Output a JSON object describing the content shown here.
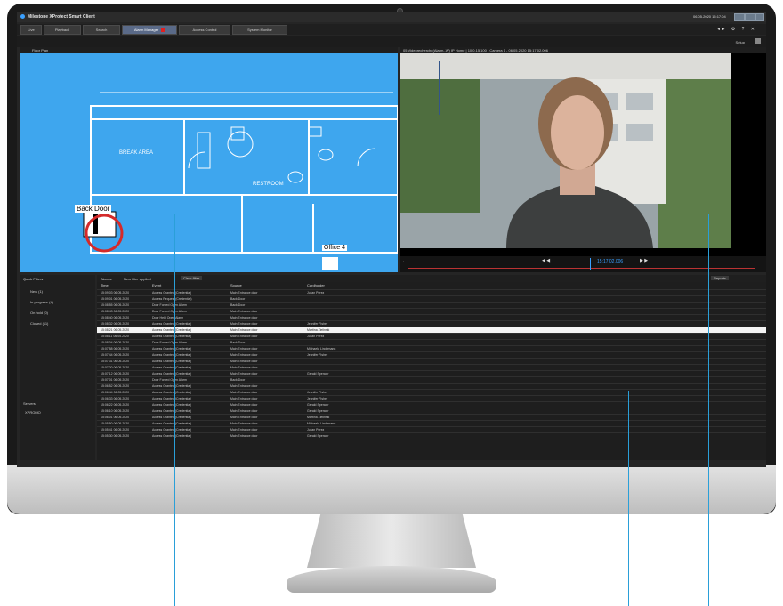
{
  "app": {
    "title": "Milestone XProtect Smart Client",
    "clock": "06.05.2020 15:17:04"
  },
  "tabs": [
    {
      "label": "Live"
    },
    {
      "label": "Playback"
    },
    {
      "label": "Search"
    },
    {
      "label": "Alarm Manager"
    },
    {
      "label": "Access Control"
    },
    {
      "label": "System Monitor"
    }
  ],
  "subbar": {
    "setup": "Setup"
  },
  "map": {
    "header": "Floor Plan",
    "labels": {
      "break_area": "BREAK AREA",
      "restroom": "RESTROOM",
      "back_door": "Back Door",
      "office": "Office 4"
    }
  },
  "video": {
    "header": "05 Videorecherche(Alarm.-W) IP Home | 10.0.15.100 - Camera 1 - 06.05.2020 15:17:02.006",
    "timecode": "15:17:02.006"
  },
  "quick_filters": {
    "title": "Quick Filters",
    "items": [
      "New (1)",
      "In progress (4)",
      "On hold (0)",
      "Closed (11)"
    ],
    "servers_title": "Servers",
    "server": "XPROMO"
  },
  "events_toolbar": {
    "alarms": "Alarms",
    "filter": "New filter applied",
    "clear": "Clear filter",
    "reports": "Reports"
  },
  "columns": [
    "Time",
    "Event",
    "Source",
    "Cardholder"
  ],
  "rows": [
    {
      "time": "15:09:03 06.05.2020",
      "event": "Access Granted (Credential)",
      "source": "Main Entrance door",
      "holder": "Julian Perez"
    },
    {
      "time": "15:09:01 06.05.2020",
      "event": "Access Request (Credential)",
      "source": "Back Door",
      "holder": ""
    },
    {
      "time": "15:08:55 06.05.2020",
      "event": "Door Forced Open Alarm",
      "source": "Back Door",
      "holder": ""
    },
    {
      "time": "15:08:43 06.05.2020",
      "event": "Door Forced Open Alarm",
      "source": "Main Entrance door",
      "holder": ""
    },
    {
      "time": "15:08:40 06.05.2020",
      "event": "Door Held Open Alarm",
      "source": "Main Entrance door",
      "holder": ""
    },
    {
      "time": "15:08:32 06.05.2020",
      "event": "Access Granted (Credential)",
      "source": "Main Entrance door",
      "holder": "Jennifer Fisher"
    },
    {
      "time": "15:08:21 06.05.2020",
      "event": "Access Granted (Credential)",
      "source": "Main Entrance door",
      "holder": "Martina Zielinski"
    },
    {
      "time": "15:08:11 06.05.2020",
      "event": "Access Granted (Credential)",
      "source": "Main Entrance door",
      "holder": "Julian Perez"
    },
    {
      "time": "15:08:04 06.05.2020",
      "event": "Door Forced Open Alarm",
      "source": "Back Door",
      "holder": ""
    },
    {
      "time": "15:07:58 06.05.2020",
      "event": "Access Granted (Credential)",
      "source": "Main Entrance door",
      "holder": "Michaela Lindemann"
    },
    {
      "time": "15:07:44 06.05.2020",
      "event": "Access Granted (Credential)",
      "source": "Main Entrance door",
      "holder": "Jennifer Fisher"
    },
    {
      "time": "15:07:31 06.05.2020",
      "event": "Access Granted (Credential)",
      "source": "Main Entrance door",
      "holder": ""
    },
    {
      "time": "15:07:20 06.05.2020",
      "event": "Access Granted (Credential)",
      "source": "Main Entrance door",
      "holder": ""
    },
    {
      "time": "15:07:12 06.05.2020",
      "event": "Access Granted (Credential)",
      "source": "Main Entrance door",
      "holder": "Gerald Spencer"
    },
    {
      "time": "15:07:01 06.05.2020",
      "event": "Door Forced Open Alarm",
      "source": "Back Door",
      "holder": ""
    },
    {
      "time": "15:06:52 06.05.2020",
      "event": "Access Granted (Credential)",
      "source": "Main Entrance door",
      "holder": ""
    },
    {
      "time": "15:06:44 06.05.2020",
      "event": "Access Granted (Credential)",
      "source": "Main Entrance door",
      "holder": "Jennifer Fisher"
    },
    {
      "time": "15:06:33 06.05.2020",
      "event": "Access Granted (Credential)",
      "source": "Main Entrance door",
      "holder": "Jennifer Fisher"
    },
    {
      "time": "15:06:22 06.05.2020",
      "event": "Access Granted (Credential)",
      "source": "Main Entrance door",
      "holder": "Gerald Spencer"
    },
    {
      "time": "15:06:10 06.05.2020",
      "event": "Access Granted (Credential)",
      "source": "Main Entrance door",
      "holder": "Gerald Spencer"
    },
    {
      "time": "15:06:01 06.05.2020",
      "event": "Access Granted (Credential)",
      "source": "Main Entrance door",
      "holder": "Martina Zielinski"
    },
    {
      "time": "15:05:50 06.05.2020",
      "event": "Access Granted (Credential)",
      "source": "Main Entrance door",
      "holder": "Michaela Lindemann"
    },
    {
      "time": "15:05:41 06.05.2020",
      "event": "Access Granted (Credential)",
      "source": "Main Entrance door",
      "holder": "Julian Perez"
    },
    {
      "time": "15:05:30 06.05.2020",
      "event": "Access Granted (Credential)",
      "source": "Main Entrance door",
      "holder": "Gerald Spencer"
    }
  ]
}
